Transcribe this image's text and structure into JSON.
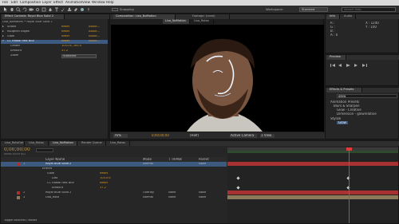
{
  "menu": [
    "File",
    "Edit",
    "Composition",
    "Layer",
    "Effect",
    "Animation",
    "View",
    "Window",
    "Help"
  ],
  "toolbar": {
    "snapping_label": "Snapping",
    "workspace_label": "Workspace:",
    "workspace_value": "Standard",
    "search_placeholder": "Search Help"
  },
  "effect_controls": {
    "tab_label": "Effect Controls: Royal Blue Solid 2",
    "breadcrumb": "Lisa_NoMotion • Royal Blue Solid 2",
    "rows": [
      {
        "name": "Stroke",
        "value": "Reset",
        "extra": "About..."
      },
      {
        "name": "Roughen Edges",
        "value": "Reset",
        "extra": "About..."
      },
      {
        "name": "Glow",
        "value": "Reset",
        "extra": "About..."
      },
      {
        "name": "CC Radial Fast Blur",
        "value": "Reset",
        "extra": "About..."
      },
      {
        "name": "Center",
        "value": "1051.6, 265.0",
        "extra": ""
      },
      {
        "name": "Amount",
        "value": "37.2",
        "extra": ""
      },
      {
        "name": "Zoom",
        "value": "Standard",
        "extra": ""
      }
    ]
  },
  "composition": {
    "tab_label": "Composition: Lisa_NoMotion",
    "footage_tab": "Footage: (none)",
    "viewer_tabs": [
      "Lisa_NoMotion",
      "Lisa_Rotos"
    ],
    "zoom": "76%",
    "timecode": "0;00;00;00",
    "resolution": "(Half)",
    "camera": "Active Camera",
    "views": "1 View"
  },
  "info_panel": {
    "tab_label": "Info",
    "tab2_label": "Audio",
    "r": "R :",
    "g": "G :",
    "b": "B :",
    "a": "A : 0",
    "x": "X : 1240",
    "y": "Y : 100"
  },
  "preview_panel": {
    "tab_label": "Preview"
  },
  "effects_presets": {
    "tab_label": "Effects & Presets",
    "search_value": "glow",
    "items": [
      "Animation Presets",
      "Blurs & Sharpen",
      "Glow - Creative",
      "Dimension - glowrelative",
      "Stylize",
      "Glow"
    ]
  },
  "timeline": {
    "tabs": [
      "Lisa_RotoOpt",
      "Lisa_Rotos",
      "Lisa_NoMotion",
      "Render Queue",
      "Lisa_Rotos"
    ],
    "timecode": "0;00;00;00",
    "fps_label": "00000 (29.97 fps)",
    "columns": [
      "Layer Name",
      "Mode",
      "T TrkMat",
      "Parent"
    ],
    "layers": [
      {
        "num": "1",
        "name": "Royal Blue Solid 2",
        "mode": "Normal",
        "trkmat": "",
        "parent": "None",
        "selected": true
      },
      {
        "num": "",
        "name": "Effects",
        "mode": "",
        "trkmat": "",
        "parent": "",
        "selected": false
      },
      {
        "num": "",
        "name": "Glow",
        "mode": "Reset",
        "trkmat": "",
        "parent": "",
        "selected": false
      },
      {
        "num": "",
        "name": "Dist",
        "mode": "100.0%",
        "trkmat": "",
        "parent": "",
        "selected": false
      },
      {
        "num": "",
        "name": "CC Radial Fast Blur",
        "mode": "Reset",
        "trkmat": "",
        "parent": "",
        "selected": false
      },
      {
        "num": "",
        "name": "Amount",
        "mode": "37.2",
        "trkmat": "",
        "parent": "",
        "selected": false
      },
      {
        "num": "2",
        "name": "Royal Blue Solid 2",
        "mode": "Overlay",
        "trkmat": "None",
        "parent": "None",
        "selected": false
      },
      {
        "num": "3",
        "name": "Lisa_Roto",
        "mode": "Normal",
        "trkmat": "None",
        "parent": "None",
        "selected": false
      }
    ],
    "bottom_label": "Toggle Switches / Modes"
  },
  "colors": {
    "accent_orange": "#d89a2a",
    "selection_blue": "#3d5a80",
    "track_red": "#a83232",
    "track_tan": "#8c7a5a",
    "playhead_red": "#e03a3a"
  }
}
